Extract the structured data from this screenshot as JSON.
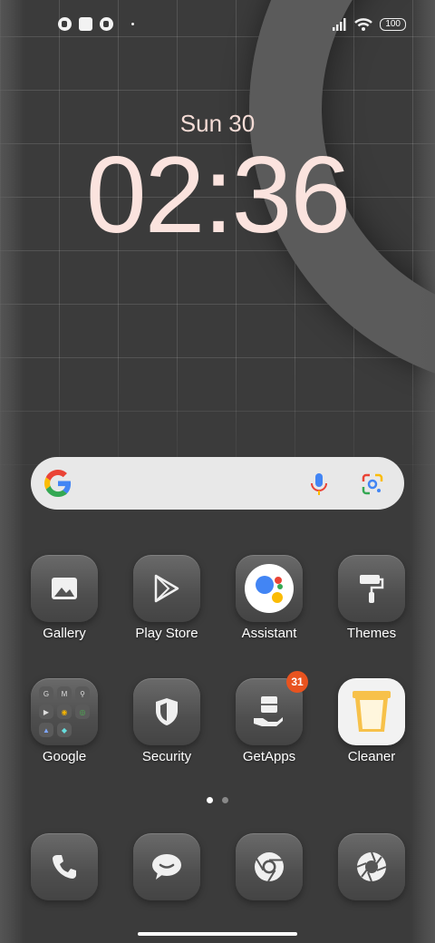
{
  "status_bar": {
    "battery": "100",
    "left_icons": [
      "app-notification-icon",
      "square-notification-icon",
      "app-notification-icon",
      "more-dot-icon"
    ],
    "right_icons": [
      "signal-icon",
      "wifi-icon",
      "battery-icon"
    ]
  },
  "clock": {
    "date": "Sun 30",
    "time": "02:36"
  },
  "search_bar": {
    "logo": "google-g-icon",
    "mic": "microphone-icon",
    "lens": "google-lens-icon"
  },
  "apps_row1": [
    {
      "label": "Gallery",
      "icon": "gallery-icon"
    },
    {
      "label": "Play Store",
      "icon": "play-store-icon"
    },
    {
      "label": "Assistant",
      "icon": "assistant-icon"
    },
    {
      "label": "Themes",
      "icon": "paint-roller-icon"
    }
  ],
  "apps_row2": [
    {
      "label": "Google",
      "icon": "folder-icon"
    },
    {
      "label": "Security",
      "icon": "shield-icon"
    },
    {
      "label": "GetApps",
      "icon": "getapps-icon",
      "badge": "31"
    },
    {
      "label": "Cleaner",
      "icon": "trash-can-icon"
    }
  ],
  "folder_google": {
    "items": [
      "G",
      "M",
      "⚲",
      "▶",
      "◉",
      "◎",
      "▲",
      "◆",
      ""
    ]
  },
  "dock": [
    {
      "icon": "phone-icon"
    },
    {
      "icon": "messages-icon"
    },
    {
      "icon": "chrome-icon"
    },
    {
      "icon": "camera-icon"
    }
  ],
  "pager": {
    "pages": 2,
    "current": 1
  },
  "colors": {
    "clock": "#fbe3de",
    "badge": "#e8531f",
    "search_bg": "#e8e8e8"
  }
}
